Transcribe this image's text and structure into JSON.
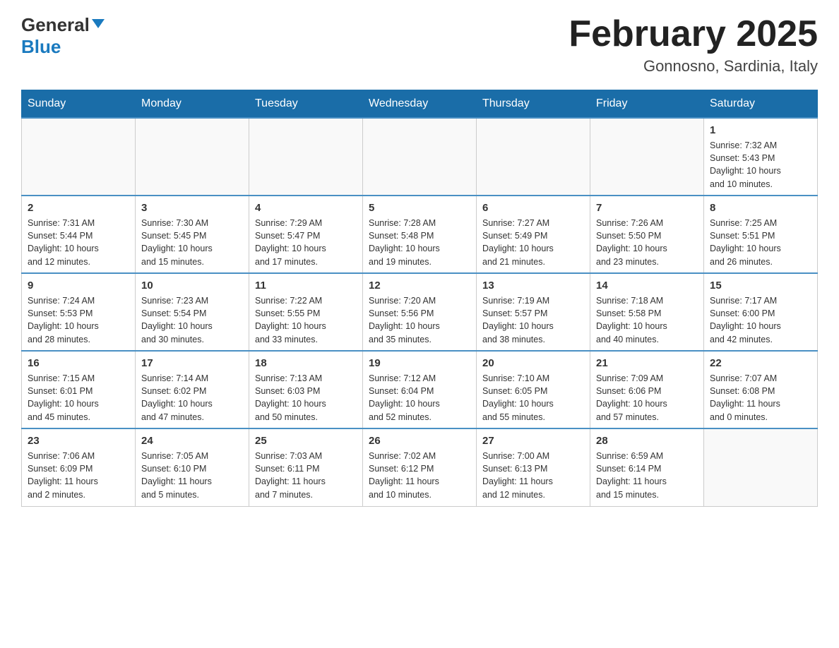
{
  "header": {
    "logo_general": "General",
    "logo_blue": "Blue",
    "month_title": "February 2025",
    "location": "Gonnosno, Sardinia, Italy"
  },
  "weekdays": [
    "Sunday",
    "Monday",
    "Tuesday",
    "Wednesday",
    "Thursday",
    "Friday",
    "Saturday"
  ],
  "weeks": [
    {
      "days": [
        {
          "num": "",
          "info": ""
        },
        {
          "num": "",
          "info": ""
        },
        {
          "num": "",
          "info": ""
        },
        {
          "num": "",
          "info": ""
        },
        {
          "num": "",
          "info": ""
        },
        {
          "num": "",
          "info": ""
        },
        {
          "num": "1",
          "info": "Sunrise: 7:32 AM\nSunset: 5:43 PM\nDaylight: 10 hours\nand 10 minutes."
        }
      ]
    },
    {
      "days": [
        {
          "num": "2",
          "info": "Sunrise: 7:31 AM\nSunset: 5:44 PM\nDaylight: 10 hours\nand 12 minutes."
        },
        {
          "num": "3",
          "info": "Sunrise: 7:30 AM\nSunset: 5:45 PM\nDaylight: 10 hours\nand 15 minutes."
        },
        {
          "num": "4",
          "info": "Sunrise: 7:29 AM\nSunset: 5:47 PM\nDaylight: 10 hours\nand 17 minutes."
        },
        {
          "num": "5",
          "info": "Sunrise: 7:28 AM\nSunset: 5:48 PM\nDaylight: 10 hours\nand 19 minutes."
        },
        {
          "num": "6",
          "info": "Sunrise: 7:27 AM\nSunset: 5:49 PM\nDaylight: 10 hours\nand 21 minutes."
        },
        {
          "num": "7",
          "info": "Sunrise: 7:26 AM\nSunset: 5:50 PM\nDaylight: 10 hours\nand 23 minutes."
        },
        {
          "num": "8",
          "info": "Sunrise: 7:25 AM\nSunset: 5:51 PM\nDaylight: 10 hours\nand 26 minutes."
        }
      ]
    },
    {
      "days": [
        {
          "num": "9",
          "info": "Sunrise: 7:24 AM\nSunset: 5:53 PM\nDaylight: 10 hours\nand 28 minutes."
        },
        {
          "num": "10",
          "info": "Sunrise: 7:23 AM\nSunset: 5:54 PM\nDaylight: 10 hours\nand 30 minutes."
        },
        {
          "num": "11",
          "info": "Sunrise: 7:22 AM\nSunset: 5:55 PM\nDaylight: 10 hours\nand 33 minutes."
        },
        {
          "num": "12",
          "info": "Sunrise: 7:20 AM\nSunset: 5:56 PM\nDaylight: 10 hours\nand 35 minutes."
        },
        {
          "num": "13",
          "info": "Sunrise: 7:19 AM\nSunset: 5:57 PM\nDaylight: 10 hours\nand 38 minutes."
        },
        {
          "num": "14",
          "info": "Sunrise: 7:18 AM\nSunset: 5:58 PM\nDaylight: 10 hours\nand 40 minutes."
        },
        {
          "num": "15",
          "info": "Sunrise: 7:17 AM\nSunset: 6:00 PM\nDaylight: 10 hours\nand 42 minutes."
        }
      ]
    },
    {
      "days": [
        {
          "num": "16",
          "info": "Sunrise: 7:15 AM\nSunset: 6:01 PM\nDaylight: 10 hours\nand 45 minutes."
        },
        {
          "num": "17",
          "info": "Sunrise: 7:14 AM\nSunset: 6:02 PM\nDaylight: 10 hours\nand 47 minutes."
        },
        {
          "num": "18",
          "info": "Sunrise: 7:13 AM\nSunset: 6:03 PM\nDaylight: 10 hours\nand 50 minutes."
        },
        {
          "num": "19",
          "info": "Sunrise: 7:12 AM\nSunset: 6:04 PM\nDaylight: 10 hours\nand 52 minutes."
        },
        {
          "num": "20",
          "info": "Sunrise: 7:10 AM\nSunset: 6:05 PM\nDaylight: 10 hours\nand 55 minutes."
        },
        {
          "num": "21",
          "info": "Sunrise: 7:09 AM\nSunset: 6:06 PM\nDaylight: 10 hours\nand 57 minutes."
        },
        {
          "num": "22",
          "info": "Sunrise: 7:07 AM\nSunset: 6:08 PM\nDaylight: 11 hours\nand 0 minutes."
        }
      ]
    },
    {
      "days": [
        {
          "num": "23",
          "info": "Sunrise: 7:06 AM\nSunset: 6:09 PM\nDaylight: 11 hours\nand 2 minutes."
        },
        {
          "num": "24",
          "info": "Sunrise: 7:05 AM\nSunset: 6:10 PM\nDaylight: 11 hours\nand 5 minutes."
        },
        {
          "num": "25",
          "info": "Sunrise: 7:03 AM\nSunset: 6:11 PM\nDaylight: 11 hours\nand 7 minutes."
        },
        {
          "num": "26",
          "info": "Sunrise: 7:02 AM\nSunset: 6:12 PM\nDaylight: 11 hours\nand 10 minutes."
        },
        {
          "num": "27",
          "info": "Sunrise: 7:00 AM\nSunset: 6:13 PM\nDaylight: 11 hours\nand 12 minutes."
        },
        {
          "num": "28",
          "info": "Sunrise: 6:59 AM\nSunset: 6:14 PM\nDaylight: 11 hours\nand 15 minutes."
        },
        {
          "num": "",
          "info": ""
        }
      ]
    }
  ]
}
